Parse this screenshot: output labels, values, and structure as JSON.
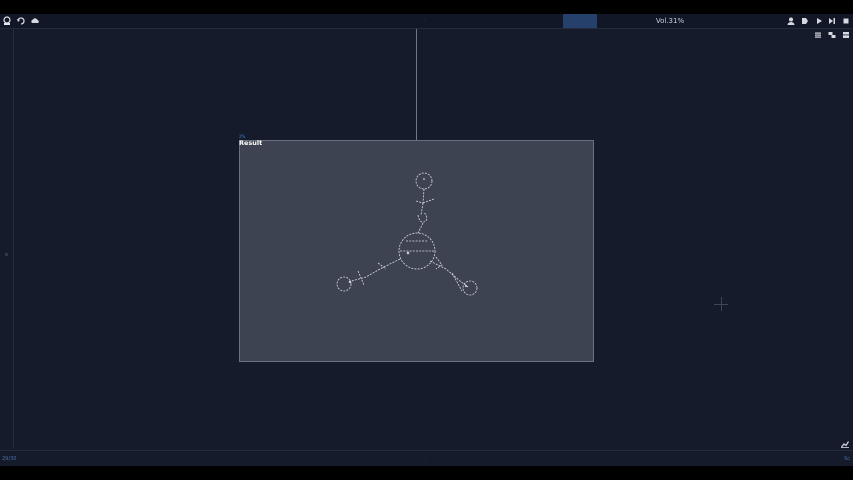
{
  "topbar": {
    "left_icons": [
      "app-logo-icon",
      "undo-icon",
      "cloud-icon"
    ],
    "title": "Vol.31%",
    "right_icons": [
      "user-icon",
      "record-icon",
      "play-icon",
      "step-icon",
      "stop-icon"
    ]
  },
  "subtoolbar": {
    "icons": [
      "list-icon",
      "layers-icon",
      "grid-icon"
    ]
  },
  "canvas": {
    "result_tag": "2%",
    "result_label": "Result"
  },
  "bottombar": {
    "left_text": "29/30",
    "right_text": "Sc"
  },
  "colors": {
    "background": "#151b2b",
    "topbar": "#111726",
    "accent_tab": "#24406b",
    "result_panel": "#3e4352",
    "sketch_lines": "#e8ecf2"
  }
}
